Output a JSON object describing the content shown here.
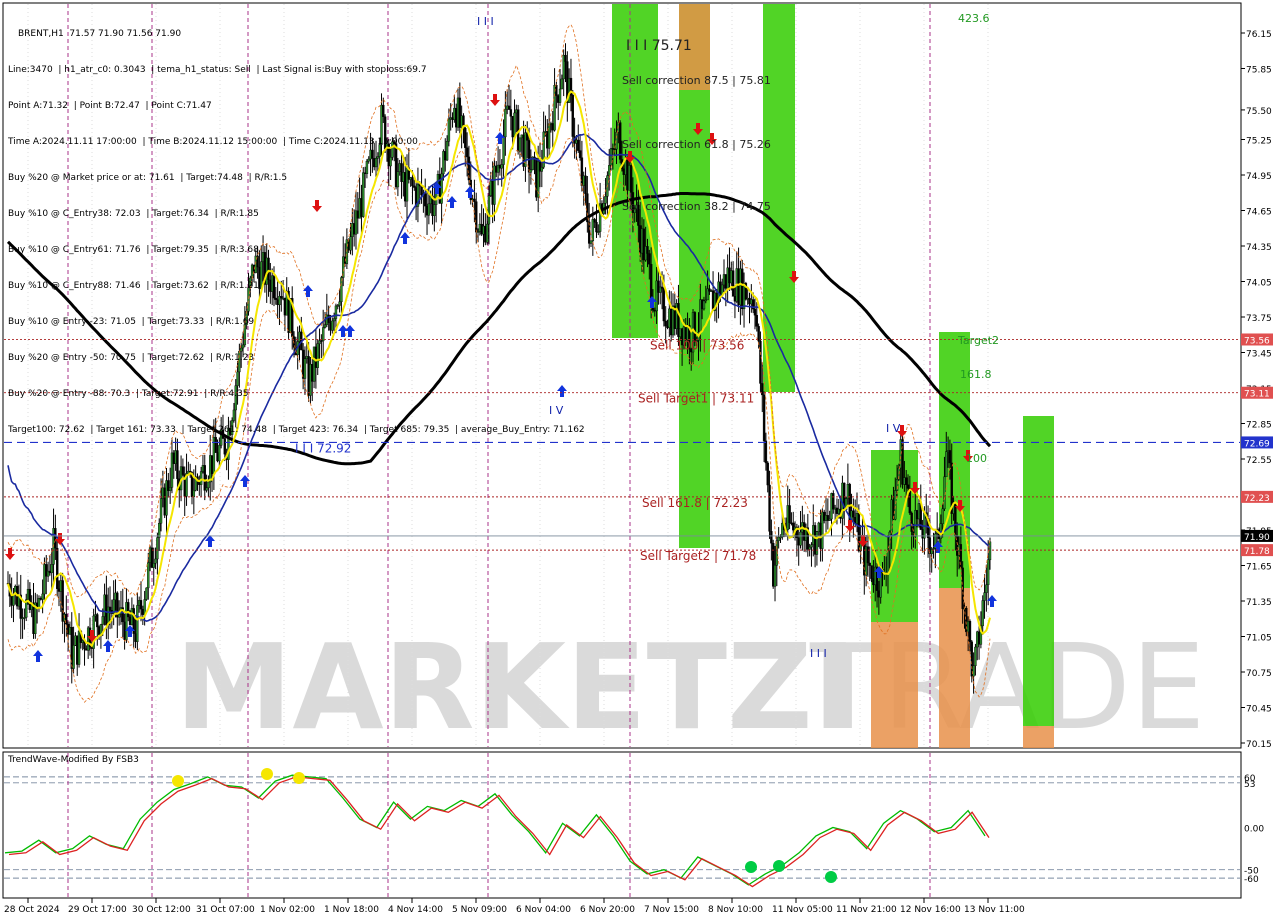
{
  "header": {
    "symbol_line": "BRENT,H1  71.57 71.90 71.56 71.90",
    "lines": [
      "Line:3470  | h1_atr_c0: 0.3043  | tema_h1_status: Sell  | Last Signal is:Buy with stoploss:69.7",
      "Point A:71.32  | Point B:72.47  | Point C:71.47",
      "Time A:2024.11.11 17:00:00  | Time B:2024.11.12 15:00:00  | Time C:2024.11.13 15:00:00",
      "Buy %20 @ Market price or at: 71.61  | Target:74.48  | R/R:1.5",
      "Buy %10 @ C_Entry38: 72.03  | Target:76.34  | R/R:1.85",
      "Buy %10 @ C_Entry61: 71.76  | Target:79.35  | R/R:3.68",
      "Buy %10 @ C_Entry88: 71.46  | Target:73.62  | R/R:1.21",
      "Buy %10 @ Entry -23: 71.05  | Target:73.33  | R/R:1.69",
      "Buy %20 @ Entry -50: 70.75  | Target:72.62  | R/R:1.23",
      "Buy %20 @ Entry -88: 70.3  | Target:72.91  | R/R:4.35",
      "Target100: 72.62  | Target 161: 73.33  | Target 261: 74.48  | Target 423: 76.34  | Target 685: 79.35  | average_Buy_Entry: 71.162"
    ]
  },
  "oscillator": {
    "title": "TrendWave-Modified By FSB3"
  },
  "chart_data": [
    {
      "type": "candlestick",
      "symbol": "BRENT",
      "timeframe": "H1",
      "ylim": [
        70.05,
        76.3
      ],
      "yticks": [
        76.15,
        75.85,
        75.5,
        75.25,
        74.95,
        74.65,
        74.35,
        74.05,
        73.75,
        73.45,
        73.15,
        72.85,
        72.55,
        72.25,
        71.95,
        71.65,
        71.35,
        71.05,
        70.75,
        70.45,
        70.15
      ],
      "xlabels": [
        "28 Oct 2024",
        "29 Oct 17:00",
        "30 Oct 12:00",
        "31 Oct 07:00",
        "1 Nov 02:00",
        "1 Nov 18:00",
        "4 Nov 14:00",
        "5 Nov 09:00",
        "6 Nov 04:00",
        "6 Nov 20:00",
        "7 Nov 15:00",
        "8 Nov 10:00",
        "11 Nov 05:00",
        "11 Nov 21:00",
        "12 Nov 16:00",
        "13 Nov 11:00"
      ],
      "price_badges": [
        {
          "value": "73.56",
          "color": "#e05050"
        },
        {
          "value": "73.11",
          "color": "#e05050"
        },
        {
          "value": "72.69",
          "color": "#2233cc"
        },
        {
          "value": "72.23",
          "color": "#e05050"
        },
        {
          "value": "71.90",
          "color": "#000000"
        },
        {
          "value": "71.78",
          "color": "#e05050"
        }
      ],
      "levels": [
        {
          "label": "Sell 100 | 73.56",
          "value": 73.56,
          "color": "#aa2222"
        },
        {
          "label": "Sell Target1 | 73.11",
          "value": 73.11,
          "color": "#aa2222"
        },
        {
          "label": "I I I 72.92",
          "value": 72.69,
          "color": "#2233cc"
        },
        {
          "label": "Sell 161.8 | 72.23",
          "value": 72.23,
          "color": "#aa2222"
        },
        {
          "label": "Sell Target2 | 71.78",
          "value": 71.78,
          "color": "#aa2222"
        }
      ],
      "annotations": [
        {
          "text": "Sell correction 87.5 | 75.81",
          "x": "7 Nov 15:00",
          "y": 75.81
        },
        {
          "text": "Sell correction 61.8 | 75.26",
          "x": "7 Nov 15:00",
          "y": 75.26
        },
        {
          "text": "Sell correction 38.2 | 74.75",
          "x": "7 Nov 15:00",
          "y": 74.75
        },
        {
          "text": "I I I 75.71",
          "x": "7 Nov 15:00",
          "y": 76.0
        },
        {
          "text": "423.6",
          "x": "13 Nov 11:00",
          "y": 76.2
        },
        {
          "text": "Target2",
          "x": "12 Nov 16:00",
          "y": 73.55
        },
        {
          "text": "161.8",
          "x": "12 Nov 16:00",
          "y": 73.25
        },
        {
          "text": "100",
          "x": "12 Nov 16:00",
          "y": 72.55
        },
        {
          "text": "I V",
          "x": "6 Nov 04:00",
          "y": 72.95
        },
        {
          "text": "I V",
          "x": "11 Nov 21:00",
          "y": 72.7
        },
        {
          "text": "I I I",
          "x": "5 Nov 09:00",
          "y": 76.2
        },
        {
          "text": "I I I",
          "x": "11 Nov 05:00",
          "y": 70.85
        }
      ],
      "watermark": "MARKETZITRADE",
      "series": [
        {
          "kind": "ma_black",
          "color": "#000000"
        },
        {
          "kind": "ma_blue",
          "color": "#1a2aa0"
        },
        {
          "kind": "trend_yellow",
          "color": "#f5e600"
        },
        {
          "kind": "envelope_orange",
          "color": "#e07020"
        }
      ]
    },
    {
      "type": "line",
      "title": "TrendWave-Modified By FSB3",
      "ylim": [
        -80,
        80
      ],
      "yticks": [
        "60",
        "53",
        "0.00",
        "-50",
        "-60"
      ],
      "series": [
        {
          "color": "#00bb00"
        },
        {
          "color": "#dd2222"
        }
      ]
    }
  ]
}
